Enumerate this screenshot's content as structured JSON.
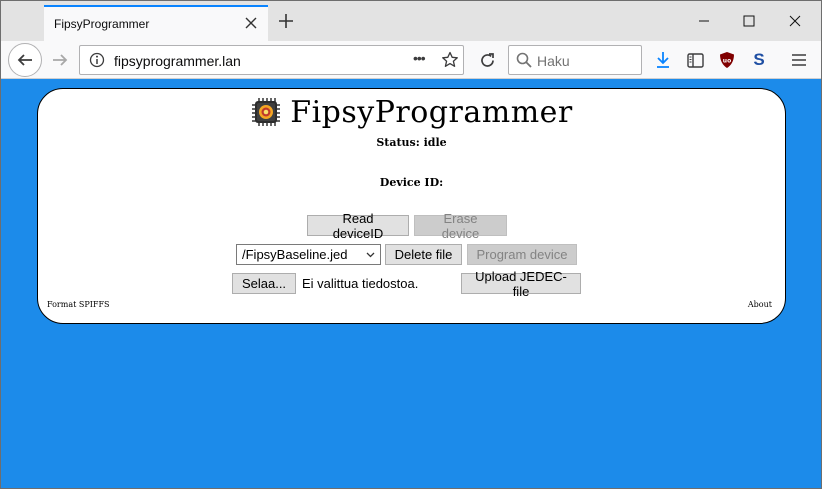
{
  "browser": {
    "tab_title": "FipsyProgrammer",
    "url": "fipsyprogrammer.lan",
    "search_placeholder": "Haku",
    "page_actions": "•••"
  },
  "app": {
    "title": "FipsyProgrammer",
    "status": "Status: idle",
    "device_id": "Device ID:",
    "buttons": {
      "read_device_id": "Read deviceID",
      "erase_device": "Erase device",
      "delete_file": "Delete file",
      "program_device": "Program device",
      "browse": "Selaa...",
      "upload_jedec": "Upload JEDEC-file"
    },
    "file_select": {
      "selected": "/FipsyBaseline.jed"
    },
    "no_file_text": "Ei valittua tiedostoa.",
    "footer": {
      "format": "Format SPIFFS",
      "about": "About"
    }
  },
  "colors": {
    "page_background": "#1c8bea",
    "card_background": "#ffffff",
    "accent_tab": "#0a84ff",
    "download_icon": "#0a84ff",
    "ublock_icon": "#800000",
    "s_icon": "#1f4fa3"
  },
  "icons": [
    "close-icon",
    "plus-icon",
    "minimize-icon",
    "maximize-icon",
    "back-arrow-icon",
    "forward-arrow-icon",
    "info-icon",
    "star-icon",
    "reload-icon",
    "search-icon",
    "download-icon",
    "sidebar-icon",
    "ublock-icon",
    "s-extension-icon",
    "menu-icon",
    "chip-logo-icon"
  ]
}
